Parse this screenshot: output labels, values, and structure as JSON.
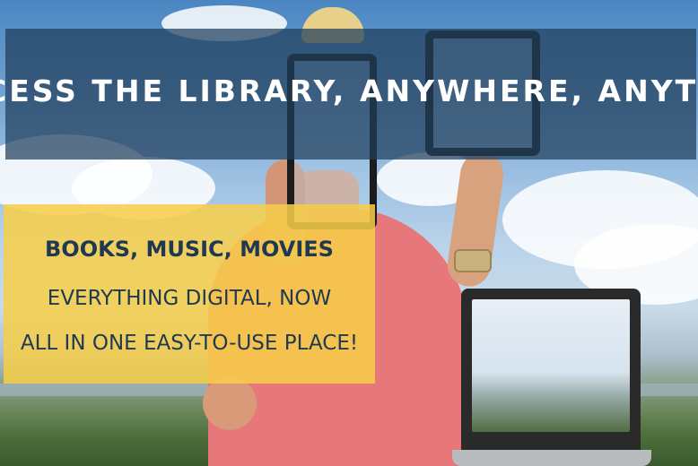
{
  "banner": {
    "headline": "ACCESS THE LIBRARY, ANYWHERE, ANYTIME",
    "promo": {
      "line1": "BOOKS, MUSIC, MOVIES",
      "line2": "EVERYTHING DIGITAL, NOW",
      "line3": "ALL IN ONE EASY-TO-USE PLACE!"
    }
  },
  "colors": {
    "top_band": "#203e5c",
    "yellow_box": "#f7ce48",
    "text_dark": "#1f3953",
    "text_light": "#ffffff"
  }
}
